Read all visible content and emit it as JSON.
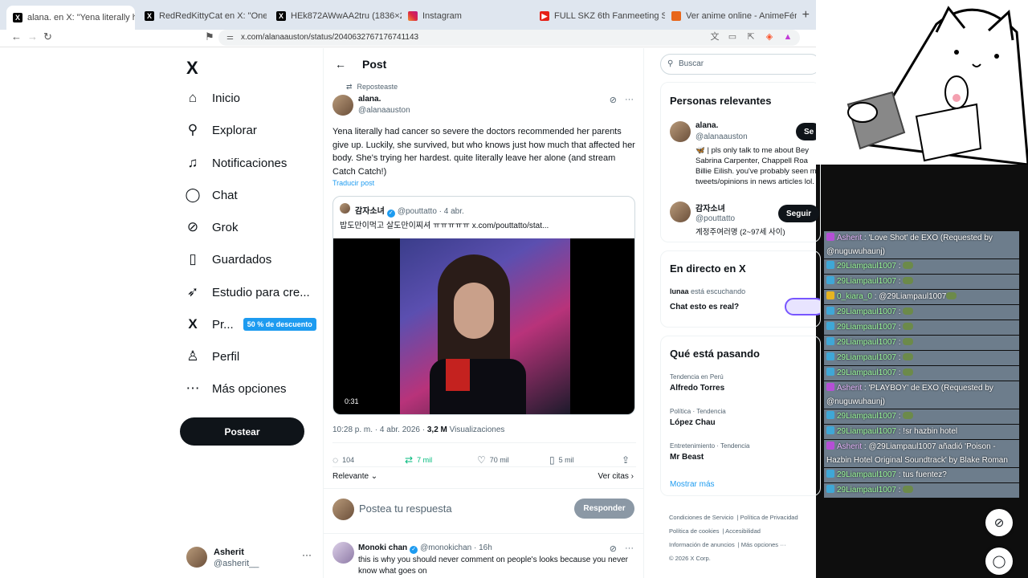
{
  "tabs": [
    {
      "title": "alana. en X: \"Yena literally had ca",
      "icon": "x-logo-icon"
    },
    {
      "title": "RedRedKittyCat en X: \"One of the El",
      "icon": "x-logo-icon"
    },
    {
      "title": "HEk872AWwAA2tru (1836×2048)",
      "icon": "x-logo-icon"
    },
    {
      "title": "Instagram",
      "icon": "instagram-icon"
    },
    {
      "title": "FULL SKZ 6th Fanmeeting STAY In Ou",
      "icon": "youtube-icon"
    },
    {
      "title": "Ver anime online - AnimeFénix",
      "icon": "animefenix-icon"
    }
  ],
  "tab_close": "×",
  "new_tab": "+",
  "url": "x.com/alanaauston/status/2040632767176741143",
  "nav": {
    "logo": "X",
    "items": [
      {
        "label": "Inicio",
        "icon": "home-icon",
        "glyph": "⌂"
      },
      {
        "label": "Explorar",
        "icon": "search-icon",
        "glyph": "⚲"
      },
      {
        "label": "Notificaciones",
        "icon": "bell-icon",
        "glyph": "🔔"
      },
      {
        "label": "Chat",
        "icon": "chat-icon",
        "glyph": "◯"
      },
      {
        "label": "Grok",
        "icon": "grok-icon",
        "glyph": "⊘"
      },
      {
        "label": "Guardados",
        "icon": "bookmark-icon",
        "glyph": "▯"
      },
      {
        "label": "Estudio para cre...",
        "icon": "rocket-icon",
        "glyph": "➶"
      },
      {
        "label": "Pr...",
        "icon": "premium-x-icon",
        "glyph": "X"
      },
      {
        "label": "Perfil",
        "icon": "profile-icon",
        "glyph": "♙"
      },
      {
        "label": "Más opciones",
        "icon": "more-icon",
        "glyph": "⋯"
      }
    ],
    "premium_badge": "50 % de descuento",
    "post_button": "Postear",
    "account": {
      "name": "Asherit",
      "handle": "@asherit__",
      "menu": "···"
    }
  },
  "post": {
    "header": "Post",
    "reposted": "Reposteaste",
    "name": "alana.",
    "handle": "@alanaauston",
    "text": "Yena literally had cancer so severe the doctors recommended her parents give up. Luckily, she survived, but who knows just how much that affected her body. She's trying her hardest. quite literally leave her alone (and stream Catch Catch!)",
    "translate": "Traducir post",
    "quote": {
      "name": "감자소녀",
      "handle": "@pouttatto",
      "date": "· 4 abr.",
      "text": "밥도만이먹고 살도만이찌셔 ㅠㅠㅠㅠㅠ x.com/pouttatto/stat...",
      "video_time": "0:31"
    },
    "time": "10:28 p. m. · 4 abr. 2026 ·",
    "views": "3,2 M",
    "views_label": "Visualizaciones",
    "actions": {
      "replies": "104",
      "reposts": "7 mil",
      "likes": "70 mil",
      "bookmarks": "5 mil"
    },
    "relevant": "Relevante",
    "quotes": "Ver citas"
  },
  "reply": {
    "placeholder": "Postea tu respuesta",
    "button": "Responder"
  },
  "comment": {
    "name": "Monoki chan",
    "handle": "@monokichan",
    "date": "· 16h",
    "text": "this is why you should never comment on people's looks because you never know what goes on"
  },
  "right": {
    "search_placeholder": "Buscar",
    "relevant_title": "Personas relevantes",
    "people": [
      {
        "name": "alana.",
        "handle": "@alanaauston",
        "bio": "🦋 | pls only talk to me about Bey Sabrina Carpenter, Chappell Roa Billie Eilish. you've probably seen m tweets/opinions in news articles lol.",
        "button": "Se"
      },
      {
        "name": "감자소녀",
        "handle": "@pouttatto",
        "bio": "계정주여러명 (2~97세 사이)",
        "button": "Seguir"
      }
    ],
    "live_title": "En directo en X",
    "live_user": "lunaa",
    "live_status": "está escuchando",
    "live_text": "Chat esto es real?",
    "trends_title": "Qué está pasando",
    "trends": [
      {
        "category": "Tendencia en Perú",
        "name": "Alfredo Torres"
      },
      {
        "category": "Política · Tendencia",
        "name": "López Chau"
      },
      {
        "category": "Entretenimiento · Tendencia",
        "name": "Mr Beast"
      }
    ],
    "show_more": "Mostrar más",
    "footer": [
      "Condiciones de Servicio",
      "Política de Privacidad",
      "Política de cookies",
      "Accesibilidad",
      "Información de anuncios",
      "Más opciones ···",
      "© 2026 X Corp."
    ]
  },
  "chat": [
    {
      "user": "Asherit",
      "text": "'Love Shot' de EXO (Requested by @nuguwuhaunj)",
      "type": "p",
      "tall": true
    },
    {
      "user": "29Liampaul1007",
      "text": "",
      "emote": true
    },
    {
      "user": "29Liampaul1007",
      "text": "",
      "emote": true
    },
    {
      "user": "0_kiara_0",
      "text": "@29Liampaul1007",
      "type": "y",
      "emote": true
    },
    {
      "user": "29Liampaul1007",
      "text": "",
      "emote": true
    },
    {
      "user": "29Liampaul1007",
      "text": "",
      "emote": true
    },
    {
      "user": "29Liampaul1007",
      "text": "",
      "emote": true
    },
    {
      "user": "29Liampaul1007",
      "text": "",
      "emote": true
    },
    {
      "user": "29Liampaul1007",
      "text": "",
      "emote": true
    },
    {
      "user": "Asherit",
      "text": "'PLAYBOY' de EXO (Requested by @nuguwuhaunj)",
      "type": "p",
      "tall": true
    },
    {
      "user": "29Liampaul1007",
      "text": "",
      "emote": true
    },
    {
      "user": "29Liampaul1007",
      "text": "!sr hazbin hotel"
    },
    {
      "user": "Asherit",
      "text": "@29Liampaul1007 añadió 'Poison - Hazbin Hotel Original Soundtrack' by Blake Roman",
      "type": "p",
      "tall": true
    },
    {
      "user": "29Liampaul1007",
      "text": "tus fuentez?"
    },
    {
      "user": "29Liampaul1007",
      "text": "",
      "emote": true
    }
  ],
  "chat_handle": "@asherit__"
}
